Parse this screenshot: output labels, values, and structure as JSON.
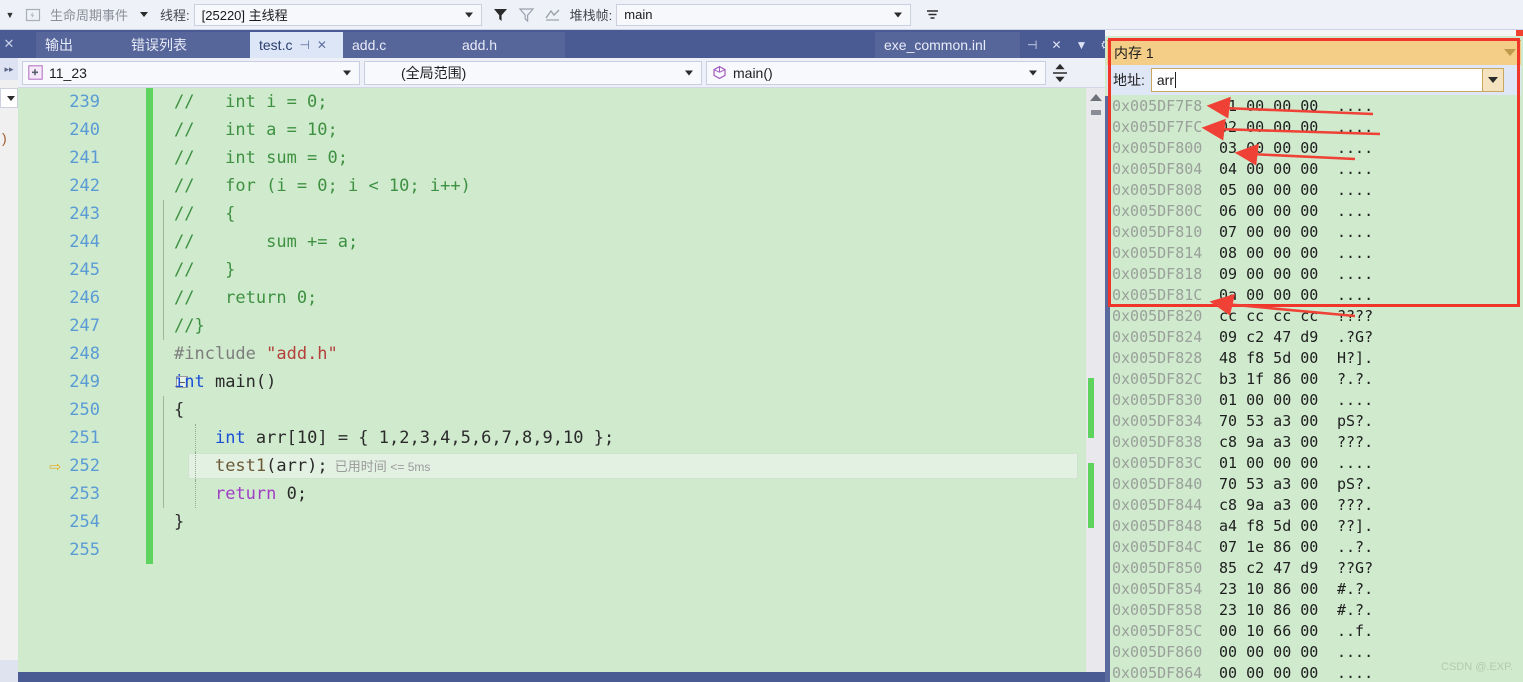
{
  "toolbar": {
    "lifecycle_label": "生命周期事件",
    "thread_label": "线程:",
    "thread_value": "[25220] 主线程",
    "frame_label": "堆栈帧:",
    "frame_value": "main",
    "icons": [
      "lifecycle-icon",
      "filter-icon",
      "filter-clear-icon",
      "zigzag-icon",
      "settings-list-icon"
    ]
  },
  "tabs": [
    {
      "label": "输出",
      "active": false
    },
    {
      "label": "错误列表",
      "active": false
    },
    {
      "label": "test.c",
      "active": true,
      "pin": "pin-icon",
      "close": "close-icon"
    },
    {
      "label": "add.c",
      "active": false
    },
    {
      "label": "add.h",
      "active": false
    }
  ],
  "tab_right": {
    "label": "exe_common.inl",
    "pin": "pin-icon",
    "close": "close-icon",
    "overflow": "chevron-down-icon",
    "settings": "gear-icon"
  },
  "navbar": {
    "project": "11_23",
    "scope": "(全局范围)",
    "member": "main()",
    "project_icon": "project-icon",
    "member_icon": "method-icon",
    "split_icon": "split-view-icon"
  },
  "editor": {
    "first_line": 239,
    "current_line": 252,
    "current_line_annotation_cjk": "已用时间",
    "current_line_annotation_small": "<= 5ms",
    "lines": [
      {
        "n": 239,
        "tokens": [
          {
            "t": "//   int i = 0;",
            "c": "cmt"
          }
        ],
        "change": true
      },
      {
        "n": 240,
        "tokens": [
          {
            "t": "//   int a = 10;",
            "c": "cmt"
          }
        ],
        "change": true
      },
      {
        "n": 241,
        "tokens": [
          {
            "t": "//   int sum = 0;",
            "c": "cmt"
          }
        ],
        "change": true
      },
      {
        "n": 242,
        "tokens": [
          {
            "t": "//   for (i = 0; i < 10; i++)",
            "c": "cmt"
          }
        ],
        "change": true
      },
      {
        "n": 243,
        "tokens": [
          {
            "t": "//   {",
            "c": "cmt"
          }
        ],
        "change": true
      },
      {
        "n": 244,
        "tokens": [
          {
            "t": "//       sum += a;",
            "c": "cmt"
          }
        ],
        "change": true
      },
      {
        "n": 245,
        "tokens": [
          {
            "t": "//   }",
            "c": "cmt"
          }
        ],
        "change": true
      },
      {
        "n": 246,
        "tokens": [
          {
            "t": "//   return 0;",
            "c": "cmt"
          }
        ],
        "change": true
      },
      {
        "n": 247,
        "tokens": [
          {
            "t": "//}",
            "c": "cmt"
          }
        ],
        "change": true
      },
      {
        "n": 248,
        "tokens": [
          {
            "t": "#include ",
            "c": "pp"
          },
          {
            "t": "\"add.h\"",
            "c": "str"
          }
        ],
        "change": true
      },
      {
        "n": 249,
        "tokens": [
          {
            "t": "int",
            "c": "kw"
          },
          {
            "t": " main()",
            "c": "pln"
          }
        ],
        "change": true,
        "fold": "−"
      },
      {
        "n": 250,
        "tokens": [
          {
            "t": "{",
            "c": "pln"
          }
        ],
        "change": true
      },
      {
        "n": 251,
        "tokens": [
          {
            "t": "    ",
            "c": "pln"
          },
          {
            "t": "int",
            "c": "kw"
          },
          {
            "t": " arr[",
            "c": "pln"
          },
          {
            "t": "10",
            "c": "num"
          },
          {
            "t": "] = { ",
            "c": "pln"
          },
          {
            "t": "1,2,3,4,5,6,7,8,9,10",
            "c": "num"
          },
          {
            "t": " };",
            "c": "pln"
          }
        ],
        "change": true
      },
      {
        "n": 252,
        "tokens": [
          {
            "t": "    ",
            "c": "pln"
          },
          {
            "t": "test1",
            "c": "fn"
          },
          {
            "t": "(arr);",
            "c": "pln"
          }
        ],
        "change": true,
        "current": true
      },
      {
        "n": 253,
        "tokens": [
          {
            "t": "    ",
            "c": "pln"
          },
          {
            "t": "return",
            "c": "kwm"
          },
          {
            "t": " ",
            "c": "pln"
          },
          {
            "t": "0",
            "c": "num"
          },
          {
            "t": ";",
            "c": "pln"
          }
        ],
        "change": true
      },
      {
        "n": 254,
        "tokens": [
          {
            "t": "}",
            "c": "pln"
          }
        ],
        "change": true
      },
      {
        "n": 255,
        "tokens": [
          {
            "t": "",
            "c": "pln"
          }
        ],
        "change": true
      }
    ]
  },
  "memory": {
    "title": "内存 1",
    "address_label": "地址:",
    "address_value": "arr",
    "highlight_color": "#f0362a",
    "rows": [
      {
        "addr": "0x005DF7F8",
        "hex": "01 00 00 00",
        "chars": "...."
      },
      {
        "addr": "0x005DF7FC",
        "hex": "02 00 00 00",
        "chars": "...."
      },
      {
        "addr": "0x005DF800",
        "hex": "03 00 00 00",
        "chars": "...."
      },
      {
        "addr": "0x005DF804",
        "hex": "04 00 00 00",
        "chars": "...."
      },
      {
        "addr": "0x005DF808",
        "hex": "05 00 00 00",
        "chars": "...."
      },
      {
        "addr": "0x005DF80C",
        "hex": "06 00 00 00",
        "chars": "...."
      },
      {
        "addr": "0x005DF810",
        "hex": "07 00 00 00",
        "chars": "...."
      },
      {
        "addr": "0x005DF814",
        "hex": "08 00 00 00",
        "chars": "...."
      },
      {
        "addr": "0x005DF818",
        "hex": "09 00 00 00",
        "chars": "...."
      },
      {
        "addr": "0x005DF81C",
        "hex": "0a 00 00 00",
        "chars": "...."
      },
      {
        "addr": "0x005DF820",
        "hex": "cc cc cc cc",
        "chars": "????"
      },
      {
        "addr": "0x005DF824",
        "hex": "09 c2 47 d9",
        "chars": ".?G?"
      },
      {
        "addr": "0x005DF828",
        "hex": "48 f8 5d 00",
        "chars": "H?]."
      },
      {
        "addr": "0x005DF82C",
        "hex": "b3 1f 86 00",
        "chars": "?.?."
      },
      {
        "addr": "0x005DF830",
        "hex": "01 00 00 00",
        "chars": "...."
      },
      {
        "addr": "0x005DF834",
        "hex": "70 53 a3 00",
        "chars": "pS?."
      },
      {
        "addr": "0x005DF838",
        "hex": "c8 9a a3 00",
        "chars": "???."
      },
      {
        "addr": "0x005DF83C",
        "hex": "01 00 00 00",
        "chars": "...."
      },
      {
        "addr": "0x005DF840",
        "hex": "70 53 a3 00",
        "chars": "pS?."
      },
      {
        "addr": "0x005DF844",
        "hex": "c8 9a a3 00",
        "chars": "???."
      },
      {
        "addr": "0x005DF848",
        "hex": "a4 f8 5d 00",
        "chars": "??]."
      },
      {
        "addr": "0x005DF84C",
        "hex": "07 1e 86 00",
        "chars": "..?."
      },
      {
        "addr": "0x005DF850",
        "hex": "85 c2 47 d9",
        "chars": "??G?"
      },
      {
        "addr": "0x005DF854",
        "hex": "23 10 86 00",
        "chars": "#.?."
      },
      {
        "addr": "0x005DF858",
        "hex": "23 10 86 00",
        "chars": "#.?."
      },
      {
        "addr": "0x005DF85C",
        "hex": "00 10 66 00",
        "chars": "..f."
      },
      {
        "addr": "0x005DF860",
        "hex": "00 00 00 00",
        "chars": "...."
      },
      {
        "addr": "0x005DF864",
        "hex": "00 00 00 00",
        "chars": "...."
      }
    ]
  },
  "watermark": "CSDN @.EXP."
}
